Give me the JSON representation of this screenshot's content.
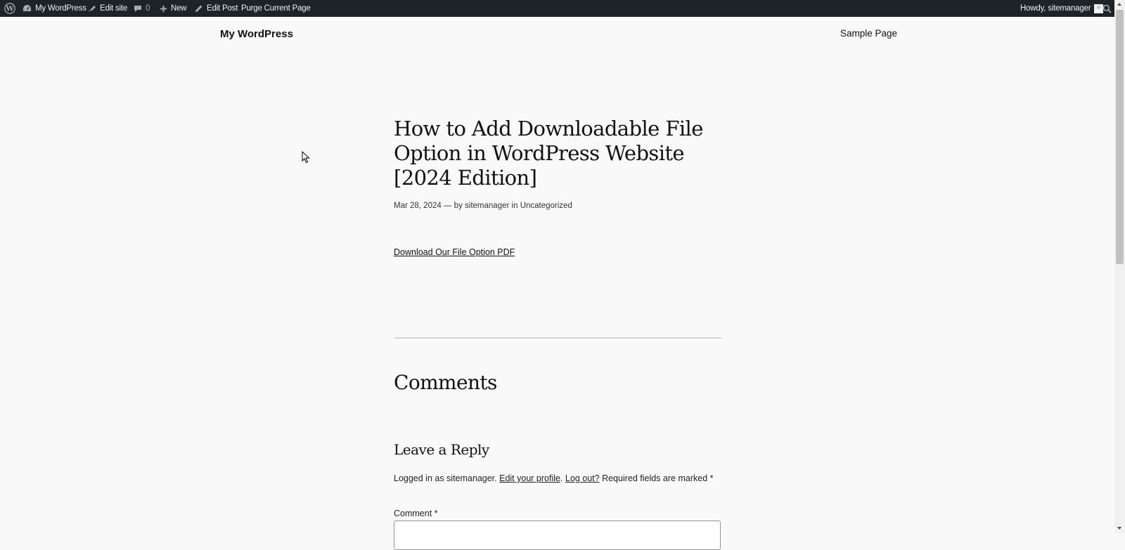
{
  "adminbar": {
    "site_name": "My WordPress",
    "edit_site": "Edit site",
    "comments_count": "0",
    "new": "New",
    "edit_post": "Edit Post",
    "purge": "Purge Current Page",
    "howdy": "Howdy, sitemanager"
  },
  "header": {
    "site_title": "My WordPress",
    "nav": [
      "Sample Page"
    ]
  },
  "post": {
    "title": "How to Add Downloadable File Option in WordPress Website [2024 Edition]",
    "date": "Mar 28, 2024",
    "meta_sep": "—",
    "by": "by",
    "author": "sitemanager",
    "in": "in",
    "category": "Uncategorized",
    "download_link": "Download Our File Option PDF"
  },
  "comments": {
    "heading": "Comments",
    "reply_title": "Leave a Reply",
    "logged_in_prefix": "Logged in as sitemanager. ",
    "edit_profile": "Edit your profile",
    "dot": ". ",
    "log_out": "Log out?",
    "required_text": " Required fields are marked ",
    "asterisk": "*",
    "comment_label": "Comment *"
  },
  "colors": {
    "adminbar_bg": "#1d2327",
    "page_bg": "#f9f9f9",
    "text": "#111111"
  }
}
